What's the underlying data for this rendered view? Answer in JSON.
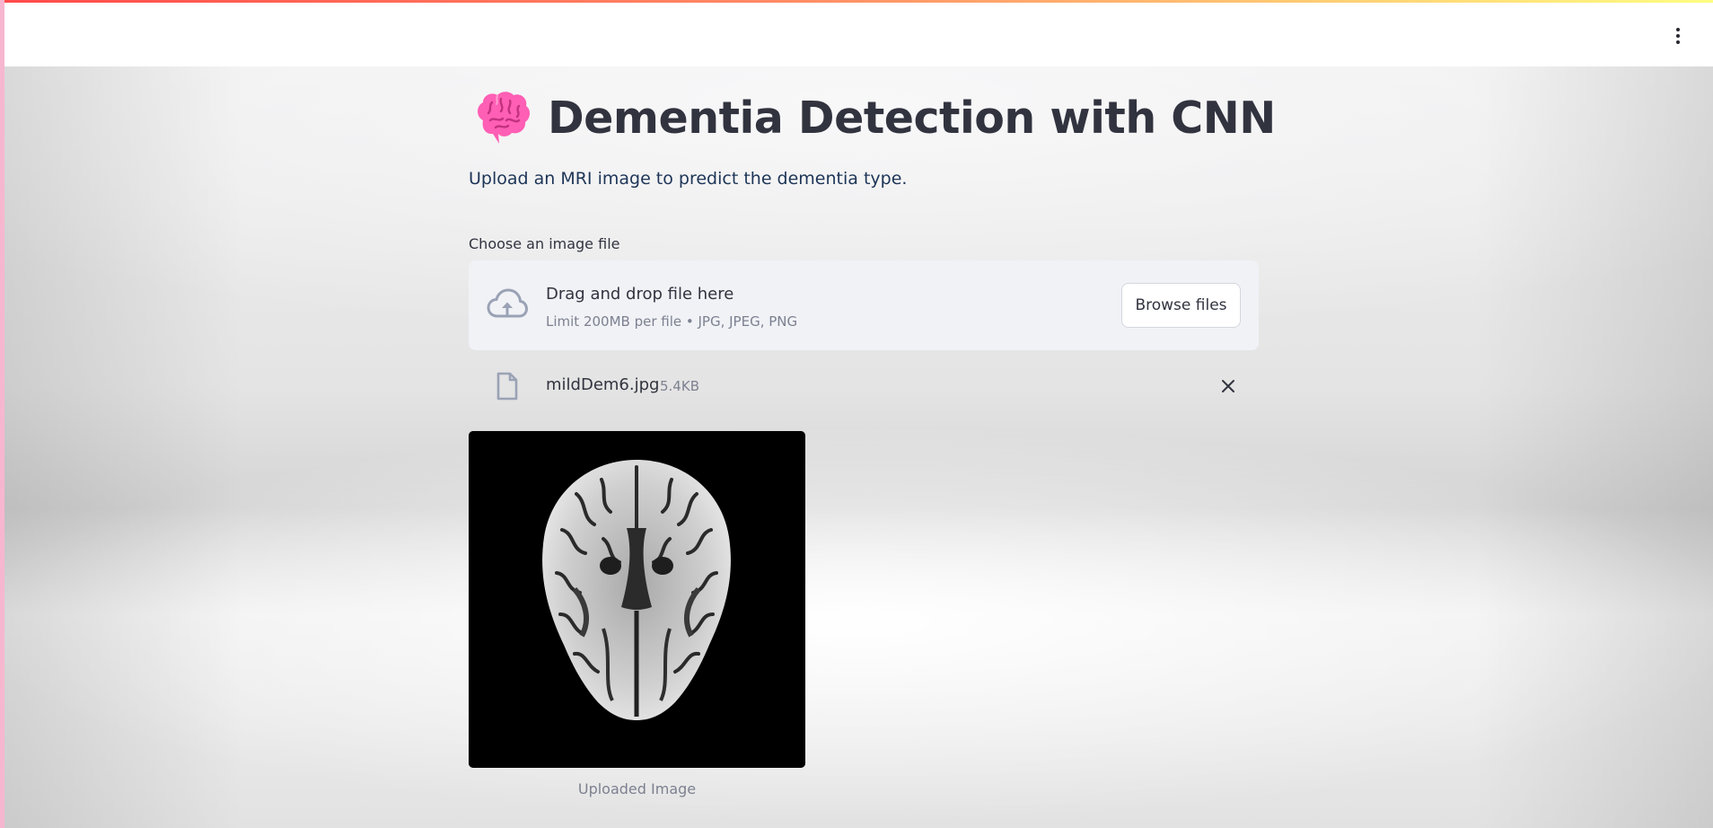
{
  "app": {
    "title_icon": "brain-icon",
    "title": "Dementia Detection with CNN",
    "subtitle": "Upload an MRI image to predict the dementia type."
  },
  "header": {
    "menu_icon": "vertical-ellipsis-icon"
  },
  "uploader": {
    "label": "Choose an image file",
    "drop_text": "Drag and drop file here",
    "limit_text": "Limit 200MB per file • JPG, JPEG, PNG",
    "browse_label": "Browse files",
    "upload_icon": "cloud-upload-icon"
  },
  "uploaded_file": {
    "name": "mildDem6.jpg",
    "size": "5.4KB",
    "icon": "file-icon",
    "remove_icon": "close-icon"
  },
  "image": {
    "caption": "Uploaded Image"
  },
  "colors": {
    "accent_gradient_start": "#ff4b4b",
    "accent_gradient_end": "#fffd80",
    "title_text": "#31333f",
    "subtitle_text": "#1d3557",
    "dropzone_bg": "#f0f2f6",
    "brain_pink": "#ff5fb4"
  }
}
